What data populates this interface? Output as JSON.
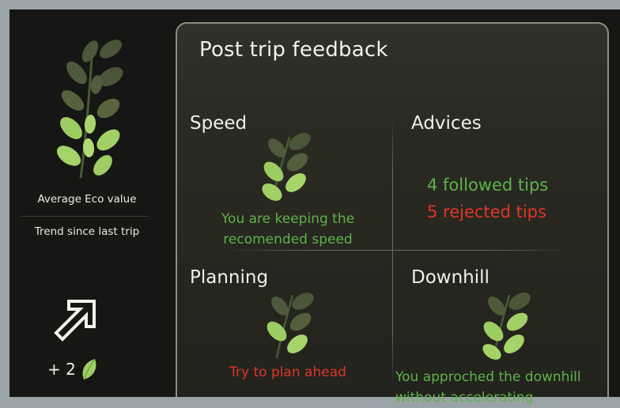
{
  "left": {
    "avg_label": "Average Eco value",
    "trend_label": "Trend since last trip",
    "trend_value": "+ 2",
    "trend_icon": "arrow-up-right-icon"
  },
  "panel": {
    "title": "Post trip feedback",
    "speed": {
      "title": "Speed",
      "message": "You are keeping the recomended speed",
      "line1": "You are keeping the",
      "line2": "recomended speed"
    },
    "advices": {
      "title": "Advices",
      "followed": "4 followed tips",
      "rejected": "5 rejected tips"
    },
    "planning": {
      "title": "Planning",
      "message": "Try to plan ahead"
    },
    "downhill": {
      "title": "Downhill",
      "line1": "You approched the downhill",
      "line2": "without accelerating"
    }
  },
  "colors": {
    "positive": "#5fb24a",
    "negative": "#e0342a",
    "leaf_dim": "#4d5a3a",
    "leaf_lit": "#a7d46a"
  }
}
